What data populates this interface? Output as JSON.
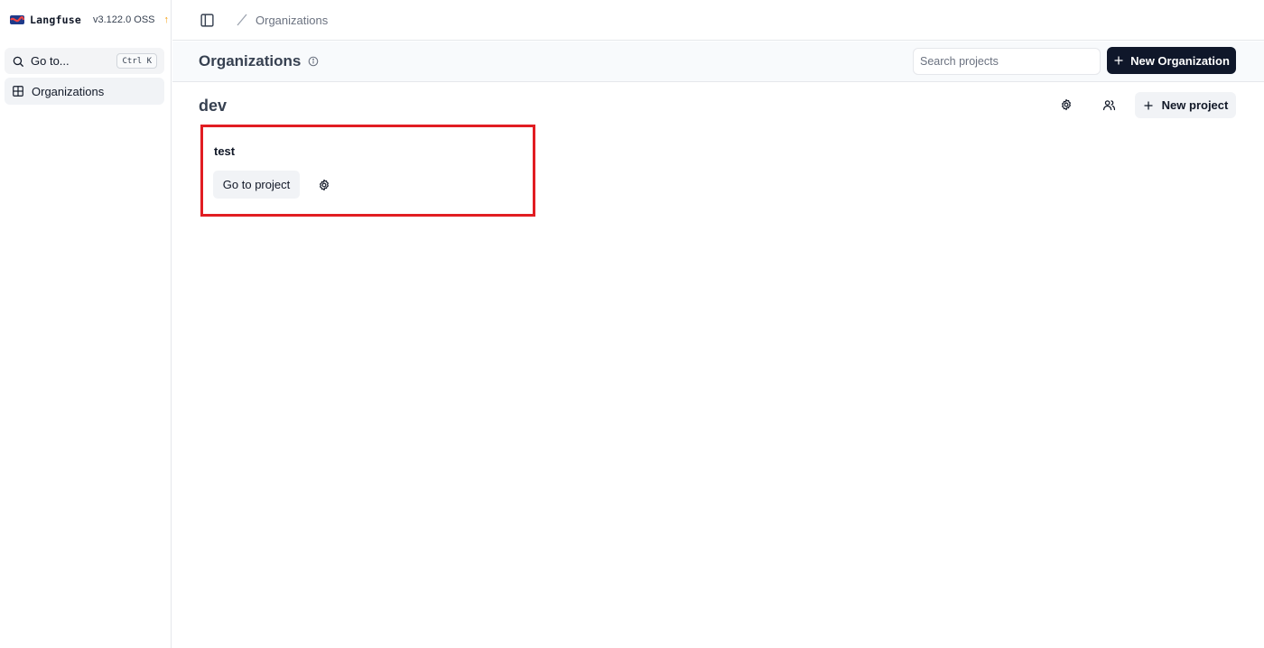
{
  "sidebar": {
    "brand_name": "Langfuse",
    "version": "v3.122.0 OSS",
    "update_indicator": "↑",
    "goto_label": "Go to...",
    "goto_shortcut": "Ctrl K",
    "nav_items": [
      {
        "label": "Organizations",
        "icon": "grid-icon"
      }
    ]
  },
  "topbar": {
    "breadcrumb": [
      "Organizations"
    ]
  },
  "header": {
    "title": "Organizations",
    "search_placeholder": "Search projects",
    "new_org_label": "New Organization"
  },
  "organization": {
    "name": "dev",
    "new_project_label": "New project",
    "projects": [
      {
        "name": "test",
        "action_label": "Go to project"
      }
    ]
  },
  "colors": {
    "primary_dark": "#0f172a",
    "highlight_border": "#e11d22",
    "update_accent": "#f59e0b"
  }
}
